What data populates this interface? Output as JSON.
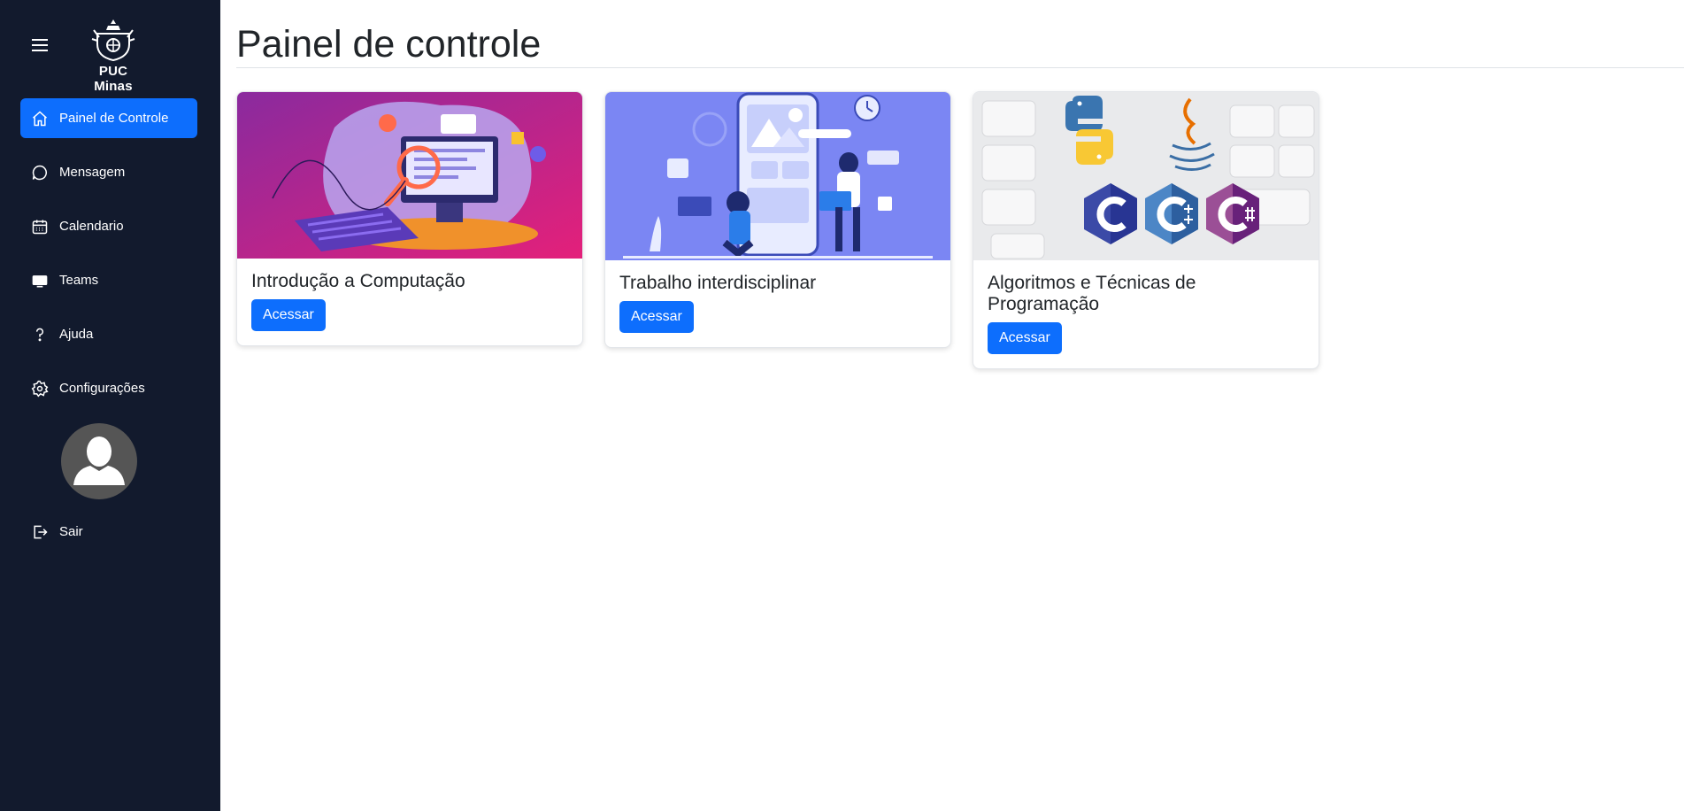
{
  "sidebar": {
    "logo_text": "PUC Minas",
    "items": [
      {
        "label": "Painel de Controle",
        "icon": "home-icon",
        "active": true
      },
      {
        "label": "Mensagem",
        "icon": "chat-icon",
        "active": false
      },
      {
        "label": "Calendario",
        "icon": "calendar-icon",
        "active": false
      },
      {
        "label": "Teams",
        "icon": "monitor-icon",
        "active": false
      },
      {
        "label": "Ajuda",
        "icon": "question-icon",
        "active": false
      },
      {
        "label": "Configurações",
        "icon": "gear-icon",
        "active": false
      }
    ],
    "logout_label": "Sair"
  },
  "main": {
    "title": "Painel de controle",
    "cards": [
      {
        "title": "Introdução a Computação",
        "button": "Acessar"
      },
      {
        "title": "Trabalho interdisciplinar",
        "button": "Acessar"
      },
      {
        "title": "Algoritmos e Técnicas de Programação",
        "button": "Acessar"
      }
    ]
  },
  "colors": {
    "sidebar_bg": "#121a2d",
    "accent": "#0d6efd"
  }
}
